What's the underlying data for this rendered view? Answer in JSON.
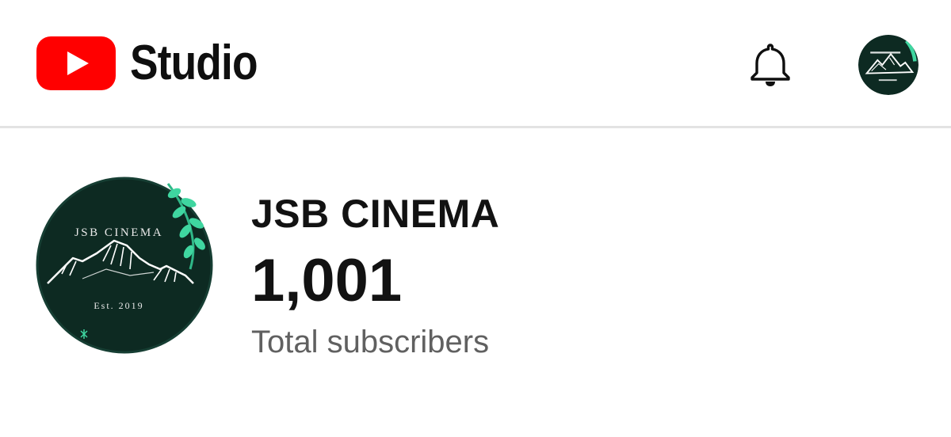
{
  "header": {
    "brand_label": "Studio",
    "icons": {
      "logo": "youtube-play-icon",
      "notifications": "bell-icon",
      "account": "channel-avatar"
    },
    "colors": {
      "brand_red": "#ff0000",
      "divider": "#e3e3e3"
    }
  },
  "channel": {
    "name": "JSB CINEMA",
    "subscriber_count": "1,001",
    "subscriber_label": "Total subscribers",
    "logo": {
      "title": "JSB CINEMA",
      "established": "Est. 2019",
      "background": "#0d2a22",
      "accent": "#3fd6a0"
    }
  }
}
